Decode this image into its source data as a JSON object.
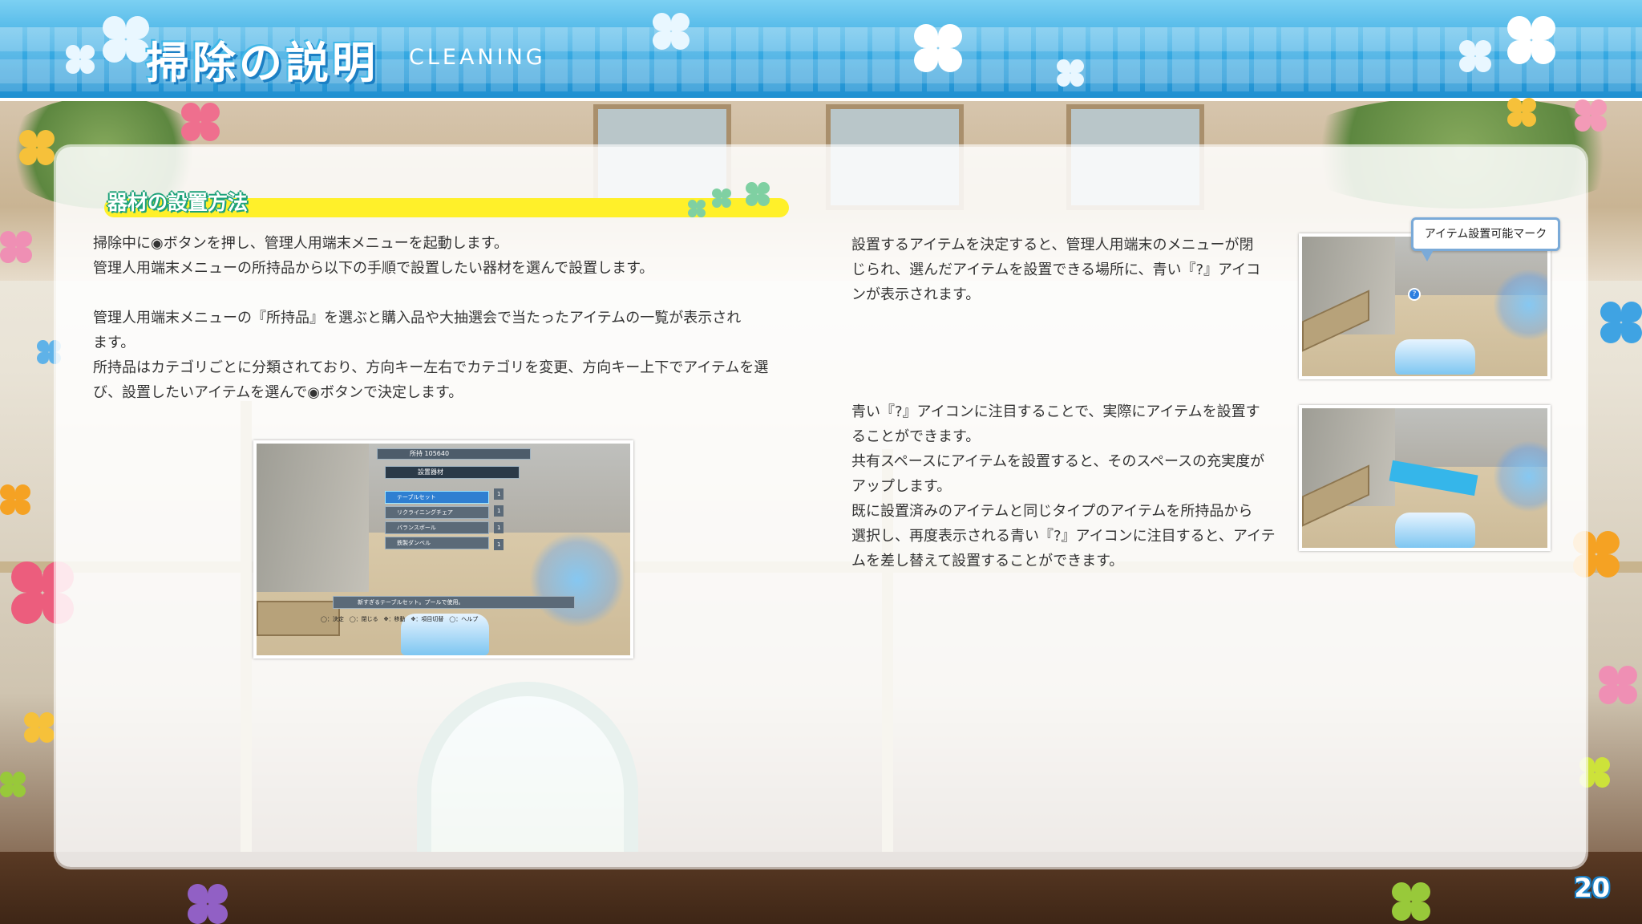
{
  "header": {
    "title_jp": "掃除の説明",
    "title_en": "CLEANING"
  },
  "section": {
    "heading": "器材の設置方法"
  },
  "left_text": {
    "p1_line1": "掃除中に◉ボタンを押し、管理人用端末メニューを起動します。",
    "p1_line2": "管理人用端末メニューの所持品から以下の手順で設置したい器材を選んで設置します。",
    "p2_line1": "管理人用端末メニューの『所持品』を選ぶと購入品や大抽選会で当たったアイテムの一覧が表示され",
    "p2_line2": "ます。",
    "p3_line1": "所持品はカテゴリごとに分類されており、方向キー左右でカテゴリを変更、方向キー上下でアイテムを選",
    "p3_line2": "び、設置したいアイテムを選んで◉ボタンで決定します。"
  },
  "right_text": {
    "a_line1": "設置するアイテムを決定すると、管理人用端末のメニューが閉",
    "a_line2": "じられ、選んだアイテムを設置できる場所に、青い『?』アイコ",
    "a_line3": "ンが表示されます。",
    "b_line1": "青い『?』アイコンに注目することで、実際にアイテムを設置す",
    "b_line2": "ることができます。",
    "b_line3": "共有スペースにアイテムを設置すると、そのスペースの充実度が",
    "b_line4": "アップします。",
    "b_line5": "既に設置済みのアイテムと同じタイプのアイテムを所持品から",
    "b_line6": "選択し、再度表示される青い『?』アイコンに注目すると、アイテ",
    "b_line7": "ムを差し替えて設置することができます。"
  },
  "callout": {
    "label": "アイテム設置可能マーク"
  },
  "menu_shot": {
    "money": "所持 105640",
    "category": "設置器材",
    "items": [
      "テーブルセット",
      "リクライニングチェア",
      "バランスボール",
      "鉄製ダンベル"
    ],
    "counts": [
      "1",
      "1",
      "1",
      "1"
    ],
    "description": "新すぎるテーブルセット。プールで使用。",
    "controls": "◯：決定　◯：閉じる　✥：移動　✥：項目切替　◯：ヘルプ"
  },
  "page_number": "20",
  "colors": {
    "header_blue": "#36a9e2",
    "heading_bar": "#fff02a",
    "heading_outline": "#1ea27a"
  }
}
